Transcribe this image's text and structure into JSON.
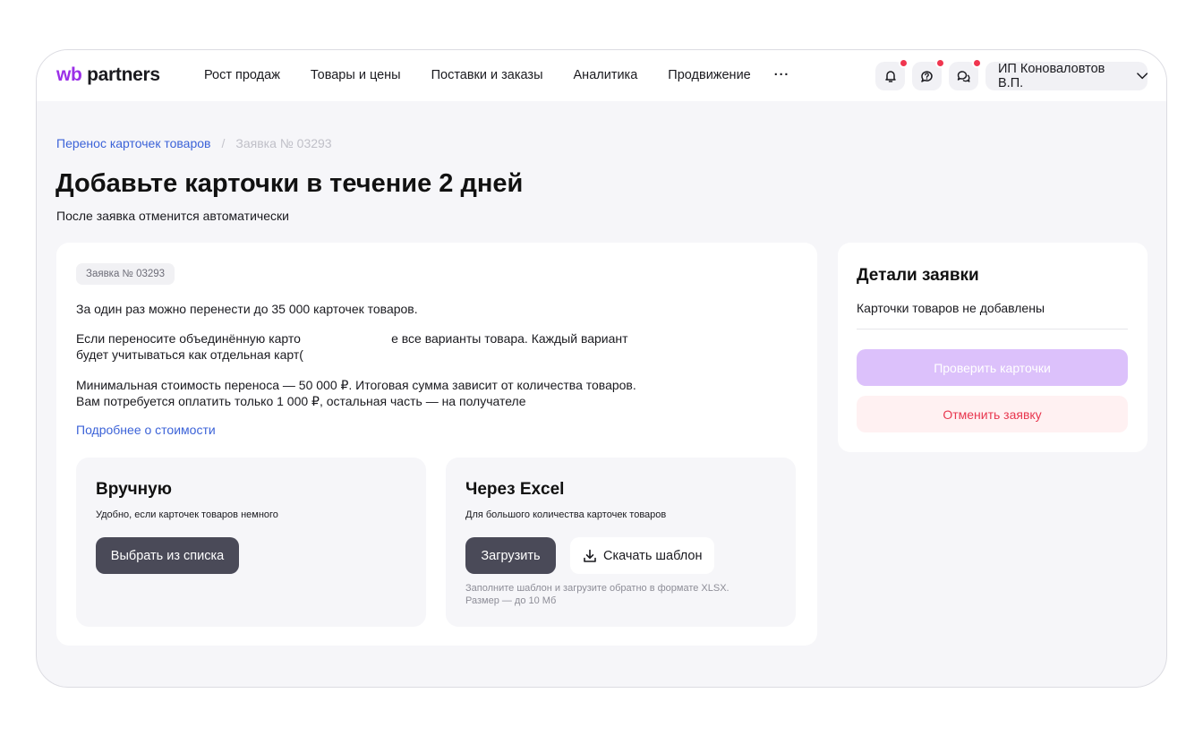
{
  "header": {
    "logo_wb": "wb",
    "logo_partners": "partners",
    "nav": [
      "Рост продаж",
      "Товары и цены",
      "Поставки и заказы",
      "Аналитика",
      "Продвижение"
    ],
    "more": "···",
    "user": "ИП Коноваловтов В.П."
  },
  "breadcrumb": {
    "parent": "Перенос карточек товаров",
    "separator": "/",
    "current": "Заявка № 03293"
  },
  "page": {
    "title": "Добавьте карточки в течение 2 дней",
    "subtitle": "После заявка отменится автоматически"
  },
  "main": {
    "badge": "Заявка № 03293",
    "p1": "За один раз можно перенести до 35 000 карточек товаров.",
    "p2_l1": "Если переносите объединённую карто                          е все варианты товара. Каждый вариант",
    "p2_l2": "будет учитываться как отдельная карт(",
    "p3_l1": "Минимальная стоимость переноса — 50 000 ₽. Итоговая сумма зависит от количества товаров.",
    "p3_l2": "Вам потребуется оплатить только 1 000 ₽, остальная часть — на получателе",
    "more_link": "Подробнее о стоимости"
  },
  "manual": {
    "title": "Вручную",
    "desc": "Удобно, если карточек товаров немного",
    "button": "Выбрать из списка"
  },
  "excel": {
    "title": "Через Excel",
    "desc": "Для большого количества карточек товаров",
    "upload": "Загрузить",
    "download": "Скачать шаблон",
    "hint_l1": "Заполните шаблон и загрузите обратно в формате XLSX.",
    "hint_l2": "Размер — до 10 Мб"
  },
  "details": {
    "title": "Детали заявки",
    "text": "Карточки товаров не добавлены",
    "check": "Проверить карточки",
    "cancel": "Отменить заявку"
  },
  "colors": {
    "brand": "#9b2fe8",
    "link": "#3c63d8",
    "notification": "#f0364f",
    "danger": "#e8374f"
  },
  "icons": [
    "bell-icon",
    "support-icon",
    "chat-icon",
    "chevron-down-icon",
    "download-icon"
  ]
}
